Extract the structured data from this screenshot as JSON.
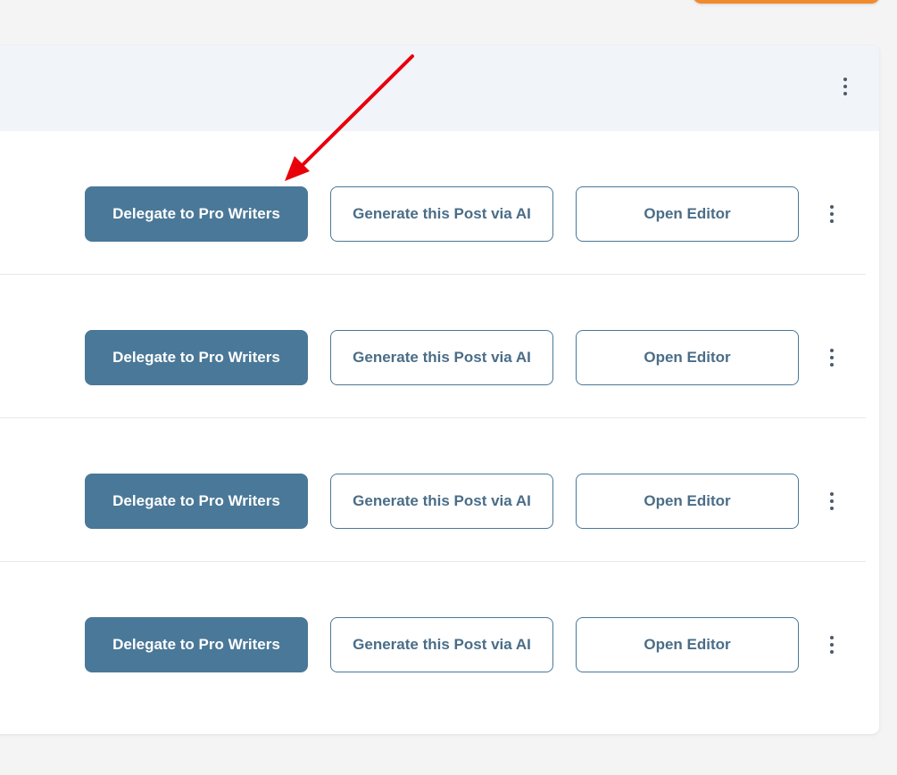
{
  "accent_color": "#4a7898",
  "orange_accent": "#f28a2e",
  "annotation_color": "#e8000b",
  "header": {
    "menu_icon": "vertical-ellipsis-icon"
  },
  "rows": [
    {
      "delegate_label": "Delegate to Pro Writers",
      "generate_label": "Generate this Post via AI",
      "editor_label": "Open Editor",
      "menu_icon": "vertical-ellipsis-icon"
    },
    {
      "delegate_label": "Delegate to Pro Writers",
      "generate_label": "Generate this Post via AI",
      "editor_label": "Open Editor",
      "menu_icon": "vertical-ellipsis-icon"
    },
    {
      "delegate_label": "Delegate to Pro Writers",
      "generate_label": "Generate this Post via AI",
      "editor_label": "Open Editor",
      "menu_icon": "vertical-ellipsis-icon"
    },
    {
      "delegate_label": "Delegate to Pro Writers",
      "generate_label": "Generate this Post via AI",
      "editor_label": "Open Editor",
      "menu_icon": "vertical-ellipsis-icon"
    }
  ]
}
